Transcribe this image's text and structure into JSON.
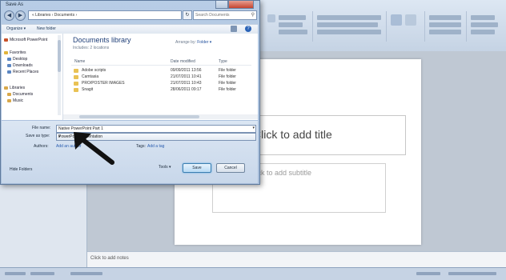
{
  "powerpoint": {
    "slide_title_placeholder": "Click to add title",
    "slide_subtitle_placeholder": "Click to add subtitle",
    "notes_placeholder": "Click to add notes"
  },
  "dialog": {
    "title": "Save As",
    "address": "« Libraries › Documents ›",
    "search_placeholder": "Search Documents",
    "toolbar": {
      "organize": "Organize ▾",
      "new_folder": "New folder",
      "help": "?"
    },
    "nav_items": [
      {
        "label": "Microsoft PowerPoint",
        "color": "#c8522a"
      },
      {
        "label": "Favorites",
        "color": "#e2b43a"
      },
      {
        "label": "Desktop",
        "color": "#5b86c2"
      },
      {
        "label": "Downloads",
        "color": "#5b86c2"
      },
      {
        "label": "Recent Places",
        "color": "#5b86c2"
      },
      {
        "label": "Libraries",
        "color": "#d8a84a"
      },
      {
        "label": "Documents",
        "color": "#d8a84a"
      },
      {
        "label": "Music",
        "color": "#d8a84a"
      }
    ],
    "library": {
      "title": "Documents library",
      "subtitle": "Includes: 2 locations",
      "arrange_label": "Arrange by:",
      "arrange_value": "Folder ▾"
    },
    "columns": {
      "name": "Name",
      "date": "Date modified",
      "type": "Type"
    },
    "files": [
      {
        "name": "Adobe scripts",
        "date": "09/09/2011 13:56",
        "type": "File folder"
      },
      {
        "name": "Camtasia",
        "date": "21/07/2011 10:41",
        "type": "File folder"
      },
      {
        "name": "PRO/POSTER IMAGES",
        "date": "21/07/2011 10:43",
        "type": "File folder"
      },
      {
        "name": "Snagit",
        "date": "28/06/2011 09:17",
        "type": "File folder"
      }
    ],
    "file_name_label": "File name:",
    "file_name_value": "Native PowerPoint Part 1",
    "save_as_type_label": "Save as type:",
    "save_as_type_value": "PowerPoint Presentation",
    "authors_label": "Authors:",
    "authors_value": "Add an author",
    "tags_label": "Tags:",
    "tags_value": "Add a tag",
    "hide_folders": "Hide Folders",
    "tools": "Tools ▾",
    "save": "Save",
    "cancel": "Cancel"
  },
  "colors": {
    "accent_save": "#b9daf4",
    "folder": "#e9c254",
    "link": "#2a5db0"
  }
}
